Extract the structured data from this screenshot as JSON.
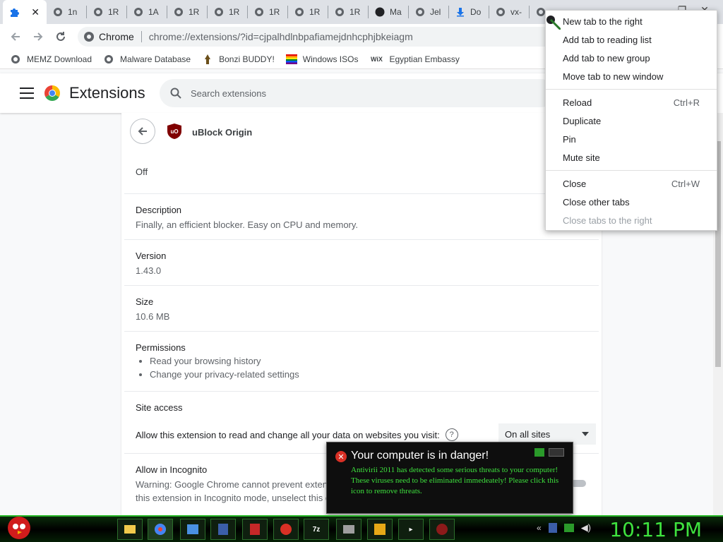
{
  "tabs": [
    {
      "label": "",
      "active": true
    },
    {
      "label": "1n"
    },
    {
      "label": "1R"
    },
    {
      "label": "1A"
    },
    {
      "label": "1R"
    },
    {
      "label": "1R"
    },
    {
      "label": "1R"
    },
    {
      "label": "1R"
    },
    {
      "label": "1R"
    },
    {
      "label": "Ma"
    },
    {
      "label": "Jel"
    },
    {
      "label": "Do"
    },
    {
      "label": "vx-"
    },
    {
      "label": ""
    }
  ],
  "omnibox": {
    "site_chip": "Chrome",
    "url": "chrome://extensions/?id=cjpalhdlnbpafiamejdnhcphjbkeiagm"
  },
  "bookmarks": [
    {
      "label": "MEMZ Download",
      "icon": "globe-icon"
    },
    {
      "label": "Malware Database",
      "icon": "globe-icon"
    },
    {
      "label": "Bonzi BUDDY!",
      "icon": "bonzi-icon"
    },
    {
      "label": "Windows ISOs",
      "icon": "windows-icon"
    },
    {
      "label": "Egyptian Embassy",
      "icon": "wix-icon"
    }
  ],
  "header": {
    "title": "Extensions",
    "search_placeholder": "Search extensions"
  },
  "extension": {
    "name": "uBlock Origin",
    "state": "Off",
    "description_heading": "Description",
    "description": "Finally, an efficient blocker. Easy on CPU and memory.",
    "version_heading": "Version",
    "version": "1.43.0",
    "size_heading": "Size",
    "size": "10.6 MB",
    "permissions_heading": "Permissions",
    "permissions": [
      "Read your browsing history",
      "Change your privacy-related settings"
    ],
    "site_access_heading": "Site access",
    "site_access_text": "Allow this extension to read and change all your data on websites you visit:",
    "site_access_value": "On all sites",
    "incognito_heading": "Allow in Incognito",
    "incognito_line1": "Warning: Google Chrome cannot prevent extensions from recording your browsing history. To disable",
    "incognito_line2": "this extension in Incognito mode, unselect this option."
  },
  "context_menu": {
    "group1": [
      {
        "label": "New tab to the right"
      },
      {
        "label": "Add tab to reading list"
      },
      {
        "label": "Add tab to new group"
      },
      {
        "label": "Move tab to new window"
      }
    ],
    "group2": [
      {
        "label": "Reload",
        "shortcut": "Ctrl+R"
      },
      {
        "label": "Duplicate"
      },
      {
        "label": "Pin"
      },
      {
        "label": "Mute site"
      }
    ],
    "group3": [
      {
        "label": "Close",
        "shortcut": "Ctrl+W"
      },
      {
        "label": "Close other tabs"
      },
      {
        "label": "Close tabs to the right",
        "disabled": true
      }
    ]
  },
  "av_popup": {
    "title": "Your computer is in danger!",
    "body1": "Antivirii 2011 has detected some serious threats to your computer!",
    "body2": "These viruses need to be eliminated immedeately! Please click this icon to remove threats."
  },
  "taskbar": {
    "clock": "10:11 PM",
    "apps": [
      "folder-icon",
      "chrome-icon",
      "explorer-icon",
      "shield-icon",
      "antivirus-icon",
      "x-icon",
      "7zip-icon",
      "drive-icon",
      "cpanel-icon",
      "terminal-icon",
      "bug-icon"
    ]
  },
  "colors": {
    "accent": "#1a73e8",
    "taskbar_green": "#3ee23e",
    "ublock_red": "#800000"
  }
}
